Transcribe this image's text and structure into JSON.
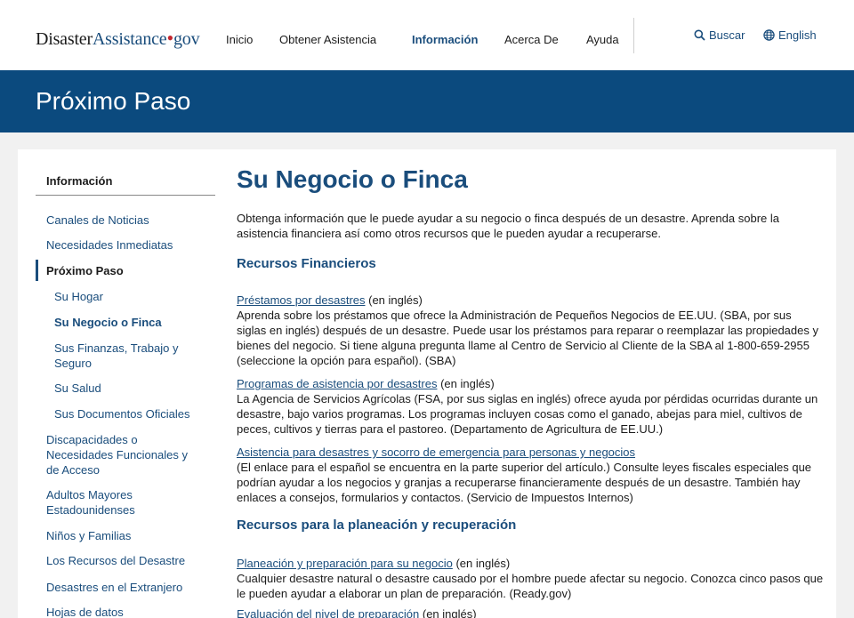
{
  "header": {
    "logo_part1": "Disaster",
    "logo_part2": "Assistance",
    "logo_dot": "•",
    "logo_part3": "gov",
    "nav": [
      {
        "label": "Inicio"
      },
      {
        "label": "Obtener Asistencia"
      },
      {
        "label": "Información"
      },
      {
        "label": "Acerca De"
      },
      {
        "label": "Ayuda"
      }
    ],
    "search_label": "Buscar",
    "language_label": "English",
    "icons": {
      "search": "search-icon",
      "language": "globe-icon"
    }
  },
  "banner": {
    "title": "Próximo Paso"
  },
  "sidebar": {
    "title": "Información",
    "items": [
      {
        "label": "Canales de Noticias"
      },
      {
        "label": "Necesidades Inmediatas"
      },
      {
        "label": "Próximo Paso"
      },
      {
        "label": "Su Hogar"
      },
      {
        "label": "Su Negocio o Finca"
      },
      {
        "label": "Sus Finanzas, Trabajo y Seguro"
      },
      {
        "label": "Su Salud"
      },
      {
        "label": "Sus Documentos Oficiales"
      },
      {
        "label": "Discapacidades o Necesidades Funcionales y de Acceso"
      },
      {
        "label": "Adultos Mayores Estadounidenses"
      },
      {
        "label": "Niños y Familias"
      },
      {
        "label": "Los Recursos del Desastre"
      },
      {
        "label": "Desastres en el Extranjero"
      },
      {
        "label": "Hojas de datos"
      }
    ]
  },
  "main": {
    "title": "Su Negocio o Finca",
    "intro": "Obtenga información que le puede ayudar a su negocio o finca después de un desastre. Aprenda sobre la asistencia financiera así como otros recursos que le pueden ayudar a recuperarse.",
    "sections": [
      {
        "heading": "Recursos Financieros",
        "resources": [
          {
            "link": "Préstamos por desastres",
            "suffix": " (en inglés)",
            "text": "Aprenda sobre los préstamos que ofrece la Administración de Pequeños Negocios de EE.UU. (SBA, por sus siglas en inglés) después de un desastre. Puede usar los préstamos para reparar o reemplazar las propiedades y bienes del negocio. Si tiene alguna pregunta llame al Centro de Servicio al Cliente de la SBA al 1-800-659-2955 (seleccione la opción para español). (SBA)"
          },
          {
            "link": "Programas de asistencia por desastres",
            "suffix": " (en inglés)",
            "text": "La Agencia de Servicios Agrícolas (FSA, por sus siglas en inglés) ofrece ayuda por pérdidas ocurridas durante un desastre, bajo varios programas. Los programas incluyen cosas como el ganado, abejas para miel, cultivos de peces, cultivos y tierras para el pastoreo. (Departamento de Agricultura de EE.UU.)"
          },
          {
            "link": "Asistencia para desastres y socorro de emergencia para personas y negocios",
            "suffix": "",
            "text": "(El enlace para el español se encuentra en la parte superior del artículo.) Consulte leyes fiscales especiales que podrían ayudar a los negocios y granjas a recuperarse financieramente después de un desastre. También hay enlaces a consejos, formularios y contactos. (Servicio de Impuestos Internos)"
          }
        ]
      },
      {
        "heading": "Recursos para la planeación y recuperación",
        "resources": [
          {
            "link": "Planeación y preparación para su negocio",
            "suffix": " (en inglés)",
            "text": "Cualquier desastre natural o desastre causado por el hombre puede afectar su negocio. Conozca cinco pasos que le pueden ayudar a elaborar un plan de preparación. (Ready.gov)"
          },
          {
            "link": "Evaluación del nivel de preparación",
            "suffix": " (en inglés)",
            "text": ""
          }
        ]
      }
    ]
  }
}
